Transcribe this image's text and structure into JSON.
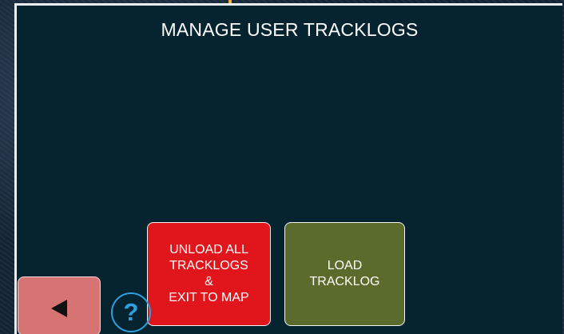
{
  "screen": {
    "title": "MANAGE USER TRACKLOGS"
  },
  "buttons": {
    "unload_label": "UNLOAD ALL\nTRACKLOGS\n&\nEXIT TO MAP",
    "load_label": "LOAD\nTRACKLOG",
    "help_label": "?"
  },
  "icons": {
    "back": "back-arrow-icon",
    "help": "help-icon"
  },
  "colors": {
    "panel_bg": "#062330",
    "unload_bg": "#e0161c",
    "load_bg": "#5b6b2b",
    "back_bg": "#d67474",
    "help_accent": "#2f9fe0"
  }
}
